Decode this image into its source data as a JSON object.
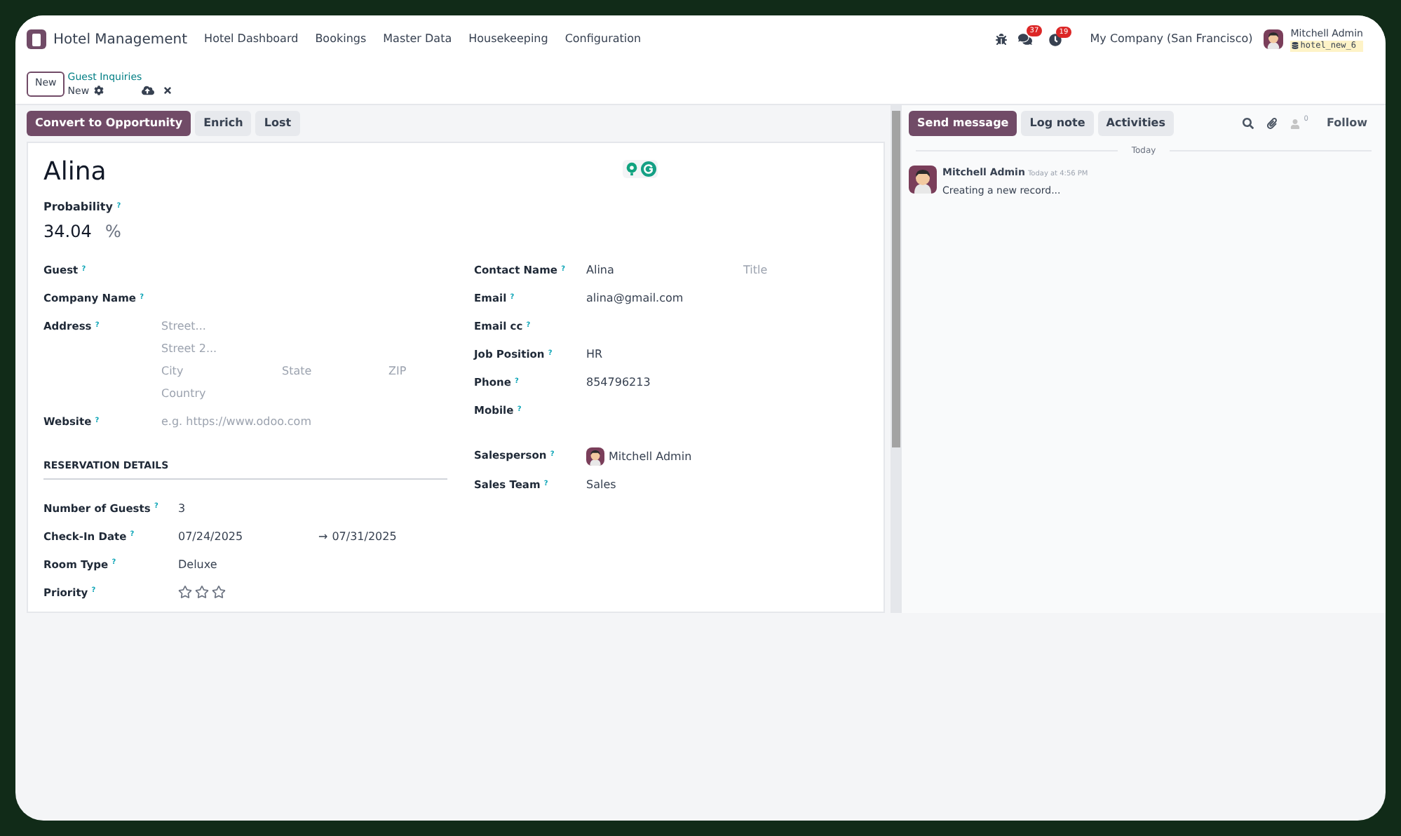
{
  "navbar": {
    "app_name": "Hotel Management",
    "menu": [
      "Hotel Dashboard",
      "Bookings",
      "Master Data",
      "Housekeeping",
      "Configuration"
    ],
    "messages_count": "37",
    "activities_count": "19",
    "company": "My Company (San Francisco)",
    "user": "Mitchell Admin",
    "database": "hotel_new_6"
  },
  "control_panel": {
    "new_button": "New",
    "breadcrumb": "Guest Inquiries",
    "record": "New"
  },
  "actions": [
    {
      "label": "Convert to Opportunity",
      "kind": "primary"
    },
    {
      "label": "Enrich",
      "kind": "secondary"
    },
    {
      "label": "Lost",
      "kind": "secondary"
    }
  ],
  "form": {
    "name": "Alina",
    "probability_label": "Probability $^{?}$",
    "probability": "34.04",
    "percent": "%",
    "left_fields": [
      {
        "label": "Guest $^{?}$",
        "kind": "empty"
      },
      {
        "label": "Company Name $^{?}$",
        "kind": "empty"
      },
      {
        "label": "Address $^{?}$",
        "kind": "address",
        "parts": [
          {
            "placeholder": "Street..."
          },
          {
            "placeholder": "Street 2..."
          },
          {
            "placeholder": "City"
          },
          {
            "placeholder": "State"
          },
          {
            "placeholder": "ZIP"
          },
          {
            "placeholder": "Country"
          }
        ]
      },
      {
        "label": "Website $^{?}$",
        "kind": "placeholder",
        "placeholder": "e.g. https://www.odoo.com"
      }
    ],
    "section_title": "RESERVATION DETAILS",
    "reservation_fields": [
      {
        "label": "Number of Guests $^{?}$",
        "kind": "value",
        "value": "3"
      },
      {
        "label": "Check-In Date $^{?}$",
        "kind": "range",
        "value": "07/24/2025",
        "arrow": "→",
        "end": "07/31/2025"
      },
      {
        "label": "Room Type $^{?}$",
        "kind": "value",
        "value": "Deluxe"
      },
      {
        "label": "Priority $^{?}$",
        "kind": "stars",
        "stars": 0
      }
    ],
    "right_fields": [
      {
        "label": "Contact Name $^{?}$",
        "kind": "value",
        "value": "Alina",
        "placeholder": "Title"
      },
      {
        "label": "Email $^{?}$",
        "kind": "value",
        "value": "alina@gmail.com"
      },
      {
        "label": "Email cc $^{?}$",
        "kind": "empty"
      },
      {
        "label": "Job Position $^{?}$",
        "kind": "value",
        "value": "HR"
      },
      {
        "label": "Phone $^{?}$",
        "kind": "value",
        "value": "854796213"
      },
      {
        "label": "Mobile $^{?}$",
        "kind": "empty"
      },
      {
        "label": "Salesperson $^{?}$",
        "kind": "user",
        "value": "Mitchell Admin"
      },
      {
        "label": "Sales Team $^{?}$",
        "kind": "value",
        "value": "Sales"
      }
    ]
  },
  "chatter": {
    "buttons": [
      {
        "label": "Send message",
        "kind": "primary"
      },
      {
        "label": "Log note",
        "kind": "secondary"
      },
      {
        "label": "Activities",
        "kind": "secondary"
      }
    ],
    "followers_count": "0",
    "follow": "Follow",
    "date_separator": "Today",
    "messages": [
      {
        "author": "Mitchell Admin",
        "time": "Today at 4:56 PM",
        "body": "Creating a new record..."
      }
    ]
  }
}
